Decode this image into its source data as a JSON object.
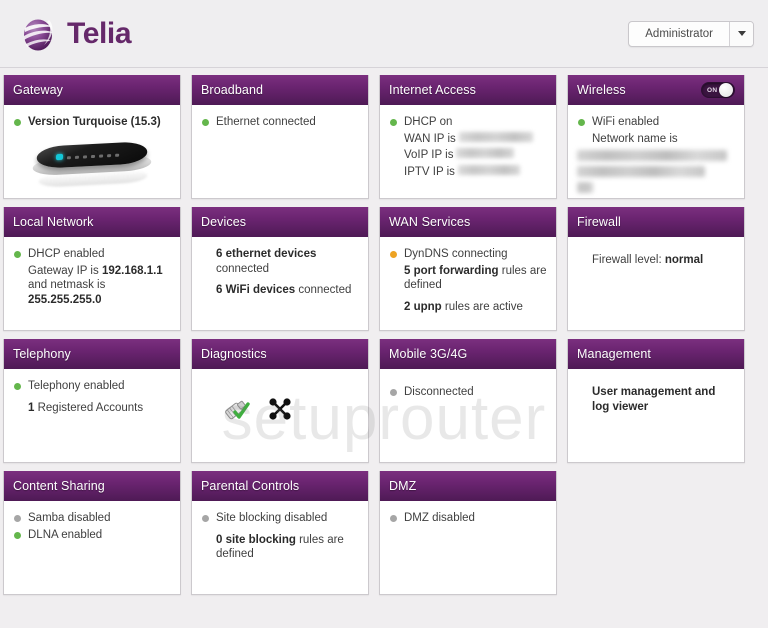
{
  "header": {
    "brand_name": "Telia",
    "logo_icon": "telia-swirl-logo",
    "account_label": "Administrator",
    "caret_icon": "chevron-down-icon"
  },
  "watermark": "setuprouter",
  "cards": [
    {
      "id": "gateway",
      "title": "Gateway",
      "lines": [
        {
          "dot": "green",
          "text": "Version Turquoise (15.3)",
          "bold": true
        }
      ],
      "image": "router-device-photo"
    },
    {
      "id": "broadband",
      "title": "Broadband",
      "lines": [
        {
          "dot": "green",
          "text": "Ethernet connected"
        }
      ]
    },
    {
      "id": "internet-access",
      "title": "Internet Access",
      "lines": [
        {
          "dot": "green",
          "text": "DHCP on"
        },
        {
          "dot": "none",
          "text": "WAN IP is",
          "redacted": true
        },
        {
          "dot": "none",
          "text": "VoIP IP is",
          "redacted": true
        },
        {
          "dot": "none",
          "text": "IPTV IP is",
          "redacted": true
        }
      ]
    },
    {
      "id": "wireless",
      "title": "Wireless",
      "toggle": {
        "state": "ON",
        "label": "ON"
      },
      "lines": [
        {
          "dot": "green",
          "text": "WiFi enabled"
        },
        {
          "dot": "none",
          "text": "Network name is"
        }
      ],
      "redacted_block": true
    },
    {
      "id": "local-network",
      "title": "Local Network",
      "lines": [
        {
          "dot": "green",
          "text": "DHCP enabled"
        },
        {
          "dot": "none",
          "html": "Gateway IP is <b>192.168.1.1</b> and netmask is <b>255.255.255.0</b>"
        }
      ],
      "gateway_ip": "192.168.1.1",
      "netmask": "255.255.255.0"
    },
    {
      "id": "devices",
      "title": "Devices",
      "lines": [
        {
          "dot": "none",
          "html": "<b>6 ethernet devices</b> connected"
        },
        {
          "dot": "none",
          "html": "<b>6 WiFi devices</b> connected"
        }
      ],
      "ethernet_devices": 6,
      "wifi_devices": 6
    },
    {
      "id": "wan-services",
      "title": "WAN Services",
      "lines": [
        {
          "dot": "orange",
          "text": "DynDNS connecting"
        },
        {
          "dot": "none",
          "html": "<b>5 port forwarding</b> rules are defined"
        },
        {
          "dot": "none",
          "html": "<b>2 upnp</b> rules are active"
        }
      ],
      "port_forwarding_rules": 5,
      "upnp_rules": 2
    },
    {
      "id": "firewall",
      "title": "Firewall",
      "lines": [
        {
          "dot": "none",
          "html": "Firewall level: <b>normal</b>"
        }
      ],
      "level": "normal"
    },
    {
      "id": "telephony",
      "title": "Telephony",
      "lines": [
        {
          "dot": "green",
          "text": "Telephony enabled"
        },
        {
          "dot": "none",
          "html": "<b>1</b> Registered Accounts"
        }
      ],
      "registered_accounts": 1
    },
    {
      "id": "diagnostics",
      "title": "Diagnostics",
      "icons": [
        "cable-test-ok-icon",
        "network-topology-icon"
      ]
    },
    {
      "id": "mobile-3g4g",
      "title": "Mobile 3G/4G",
      "lines": [
        {
          "dot": "grey",
          "text": "Disconnected"
        }
      ]
    },
    {
      "id": "management",
      "title": "Management",
      "lines": [
        {
          "dot": "none",
          "text": "User management and log viewer",
          "bold": true
        }
      ]
    },
    {
      "id": "content-sharing",
      "title": "Content Sharing",
      "lines": [
        {
          "dot": "grey",
          "text": "Samba disabled"
        },
        {
          "dot": "green",
          "text": "DLNA enabled"
        }
      ]
    },
    {
      "id": "parental-controls",
      "title": "Parental Controls",
      "lines": [
        {
          "dot": "grey",
          "text": "Site blocking disabled"
        },
        {
          "dot": "none",
          "html": "<b>0 site blocking</b> rules are defined"
        }
      ],
      "site_blocking_rules": 0
    },
    {
      "id": "dmz",
      "title": "DMZ",
      "lines": [
        {
          "dot": "grey",
          "text": "DMZ disabled"
        }
      ]
    }
  ],
  "colors": {
    "brand_purple": "#65286a",
    "header_gradient_top": "#7b2f7f",
    "header_gradient_bottom": "#4e1a55",
    "status_green": "#64b64c",
    "status_orange": "#eda323",
    "status_grey": "#a6a6a6",
    "page_background": "#f0eef0"
  }
}
